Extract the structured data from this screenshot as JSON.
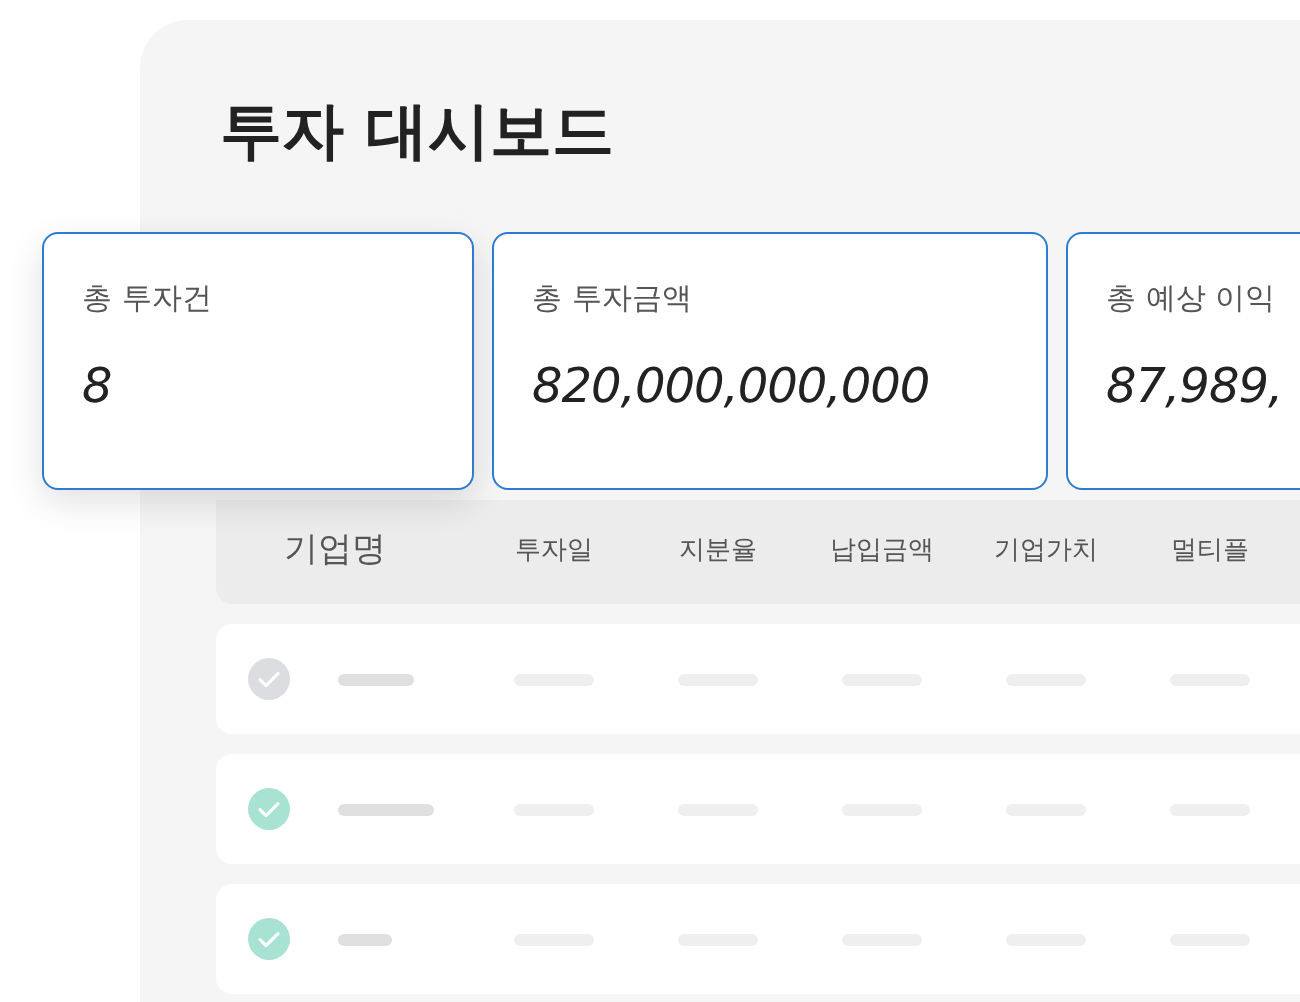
{
  "title": "투자 대시보드",
  "cards": [
    {
      "label": "총 투자건",
      "value": "8"
    },
    {
      "label": "총 투자금액",
      "value": "820,000,000,000"
    },
    {
      "label": "총 예상 이익",
      "value": "87,989,"
    }
  ],
  "table": {
    "columns": [
      "기업명",
      "투자일",
      "지분율",
      "납입금액",
      "기업가치",
      "멀티플"
    ],
    "rows": [
      {
        "checked": false
      },
      {
        "checked": true
      },
      {
        "checked": true
      }
    ]
  }
}
